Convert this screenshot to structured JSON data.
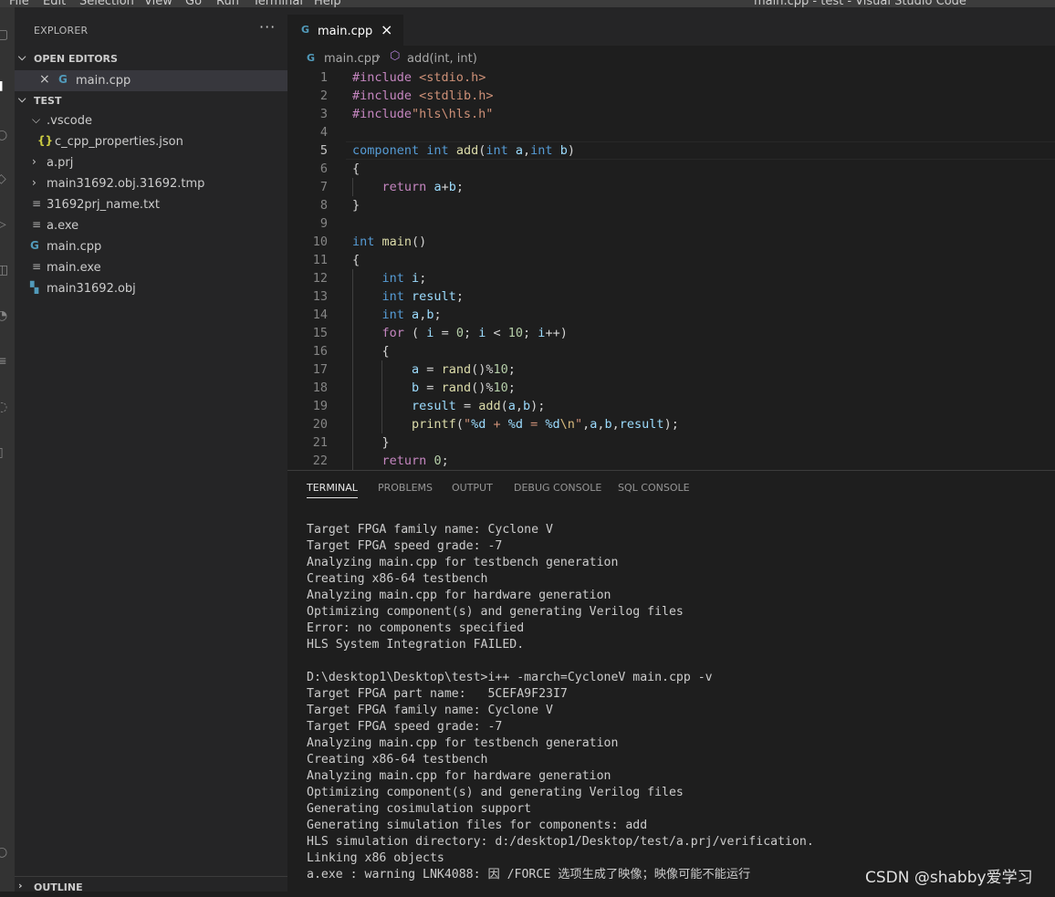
{
  "window": {
    "title": "main.cpp - test - Visual Studio Code",
    "menu": [
      "File",
      "Edit",
      "Selection",
      "View",
      "Go",
      "Run",
      "Terminal",
      "Help"
    ]
  },
  "sidebar": {
    "header": "EXPLORER",
    "more": "···",
    "open_editors": {
      "label": "OPEN EDITORS",
      "items": [
        {
          "close": "×",
          "name": "main.cpp"
        }
      ]
    },
    "folder": {
      "label": "TEST",
      "items": [
        {
          "name": ".vscode",
          "kind": "folder-open"
        },
        {
          "name": "c_cpp_properties.json",
          "kind": "json"
        },
        {
          "name": "a.prj",
          "kind": "folder-closed"
        },
        {
          "name": "main31692.obj.31692.tmp",
          "kind": "folder-closed"
        },
        {
          "name": "31692prj_name.txt",
          "kind": "text"
        },
        {
          "name": "a.exe",
          "kind": "text"
        },
        {
          "name": "main.cpp",
          "kind": "cpp"
        },
        {
          "name": "main.exe",
          "kind": "text"
        },
        {
          "name": "main31692.obj",
          "kind": "obj"
        }
      ]
    },
    "outline": "OUTLINE"
  },
  "editor": {
    "tab": {
      "label": "main.cpp",
      "close": "×"
    },
    "breadcrumb": {
      "file": "main.cpp",
      "symbol": "add(int, int)"
    },
    "current_line": 5,
    "line_numbers": [
      "1",
      "2",
      "3",
      "4",
      "5",
      "6",
      "7",
      "8",
      "9",
      "10",
      "11",
      "12",
      "13",
      "14",
      "15",
      "16",
      "17",
      "18",
      "19",
      "20",
      "21",
      "22"
    ]
  },
  "panel": {
    "tabs": [
      "TERMINAL",
      "PROBLEMS",
      "OUTPUT",
      "DEBUG CONSOLE",
      "SQL CONSOLE"
    ],
    "active_tab": "TERMINAL",
    "terminal_lines": [
      "Target FPGA family name: Cyclone V",
      "Target FPGA speed grade: -7",
      "Analyzing main.cpp for testbench generation",
      "Creating x86-64 testbench",
      "Analyzing main.cpp for hardware generation",
      "Optimizing component(s) and generating Verilog files",
      "Error: no components specified",
      "HLS System Integration FAILED.",
      "",
      "D:\\desktop1\\Desktop\\test>i++ -march=CycloneV main.cpp -v",
      "Target FPGA part name:   5CEFA9F23I7",
      "Target FPGA family name: Cyclone V",
      "Target FPGA speed grade: -7",
      "Analyzing main.cpp for testbench generation",
      "Creating x86-64 testbench",
      "Analyzing main.cpp for hardware generation",
      "Optimizing component(s) and generating Verilog files",
      "Generating cosimulation support",
      "Generating simulation files for components: add",
      "HLS simulation directory: d:/desktop1/Desktop/test/a.prj/verification.",
      "Linking x86 objects",
      "a.exe : warning LNK4088: 因 /FORCE 选项生成了映像；映像可能不能运行"
    ]
  },
  "watermark": "CSDN @shabby爱学习"
}
